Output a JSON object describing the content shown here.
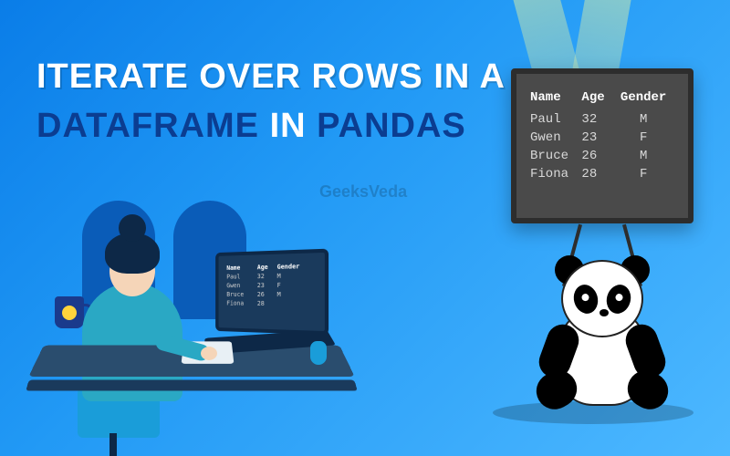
{
  "title": {
    "line1": "ITERATE OVER ROWS IN A",
    "word_dataframe": "DATAFRAME",
    "word_in": "IN",
    "word_pandas": "PANDAS"
  },
  "watermark": "GeeksVeda",
  "table": {
    "headers": [
      "Name",
      "Age",
      "Gender"
    ],
    "rows": [
      {
        "name": "Paul",
        "age": "32",
        "gender": "M"
      },
      {
        "name": "Gwen",
        "age": "23",
        "gender": "F"
      },
      {
        "name": "Bruce",
        "age": "26",
        "gender": "M"
      },
      {
        "name": "Fiona",
        "age": "28",
        "gender": "F"
      }
    ]
  }
}
